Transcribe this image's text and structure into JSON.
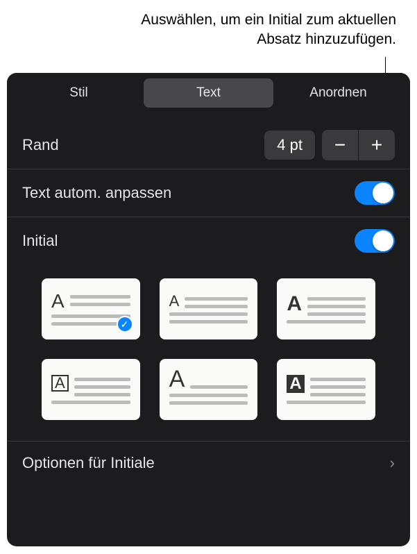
{
  "callout": "Auswählen, um ein Initial zum aktuellen Absatz hinzuzufügen.",
  "tabs": {
    "style": "Stil",
    "text": "Text",
    "arrange": "Anordnen"
  },
  "controls": {
    "rand_label": "Rand",
    "rand_value": "4 pt",
    "minus": "−",
    "plus": "+",
    "auto_fit_label": "Text autom. anpassen",
    "initial_label": "Initial"
  },
  "dropcap_styles": {
    "glyph": "A"
  },
  "options_label": "Optionen für Initiale",
  "chevron": "›"
}
